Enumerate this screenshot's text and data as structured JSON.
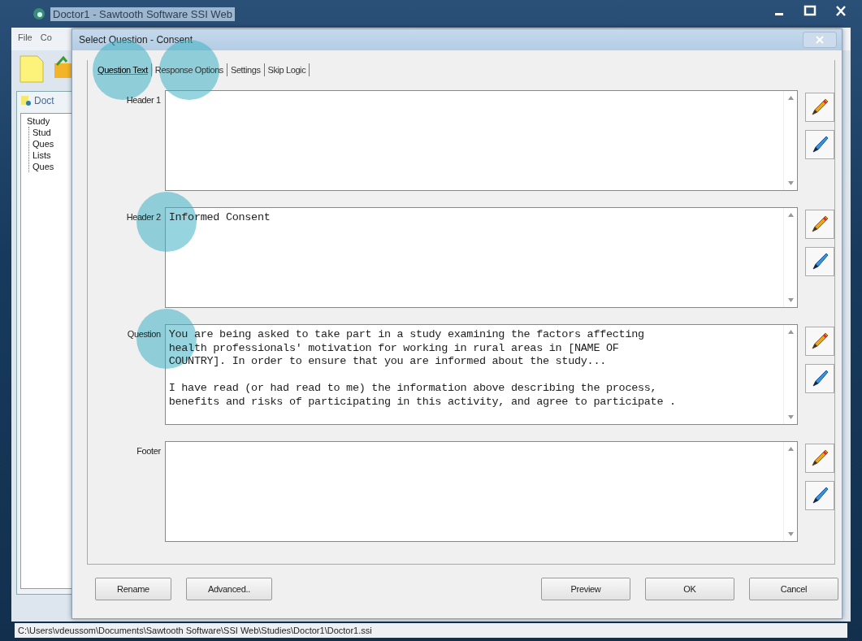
{
  "main_window": {
    "title": "Doctor1 - Sawtooth Software SSI Web",
    "menu": [
      "File",
      "Co"
    ],
    "panel_title": "Doct",
    "tree": [
      {
        "label": "Study",
        "children": [
          {
            "label": "Stud"
          },
          {
            "label": "Ques"
          },
          {
            "label": "Lists"
          },
          {
            "label": "Ques"
          }
        ]
      }
    ],
    "status_bar": "C:\\Users\\vdeussom\\Documents\\Sawtooth Software\\SSI Web\\Studies\\Doctor1\\Doctor1.ssi"
  },
  "dialog": {
    "title": "Select Question - Consent",
    "tabs": [
      {
        "label": "Question Text",
        "selected": true,
        "highlighted": true
      },
      {
        "label": "Response Options",
        "selected": false,
        "highlighted": true
      },
      {
        "label": "Settings",
        "selected": false,
        "highlighted": false
      },
      {
        "label": "Skip Logic",
        "selected": false,
        "highlighted": false
      }
    ],
    "fields": [
      {
        "label": "Header 1",
        "highlighted": false
      },
      {
        "label": "Header 2",
        "value": "Informed Consent",
        "highlighted": true
      },
      {
        "label": "Question",
        "value": "You are being asked to take part in a study examining the factors affecting\nhealth professionals' motivation for working in rural areas in [NAME OF\nCOUNTRY]. In order to ensure that you are informed about the study...\n\nI have read (or had read to me) the information above describing the process,\nbenefits and risks of participating in this activity, and agree to participate .",
        "highlighted": true
      },
      {
        "label": "Footer",
        "highlighted": false
      }
    ],
    "left_buttons": [
      "Rename",
      "Advanced.."
    ],
    "right_buttons": [
      "Preview",
      "OK",
      "Cancel"
    ]
  }
}
